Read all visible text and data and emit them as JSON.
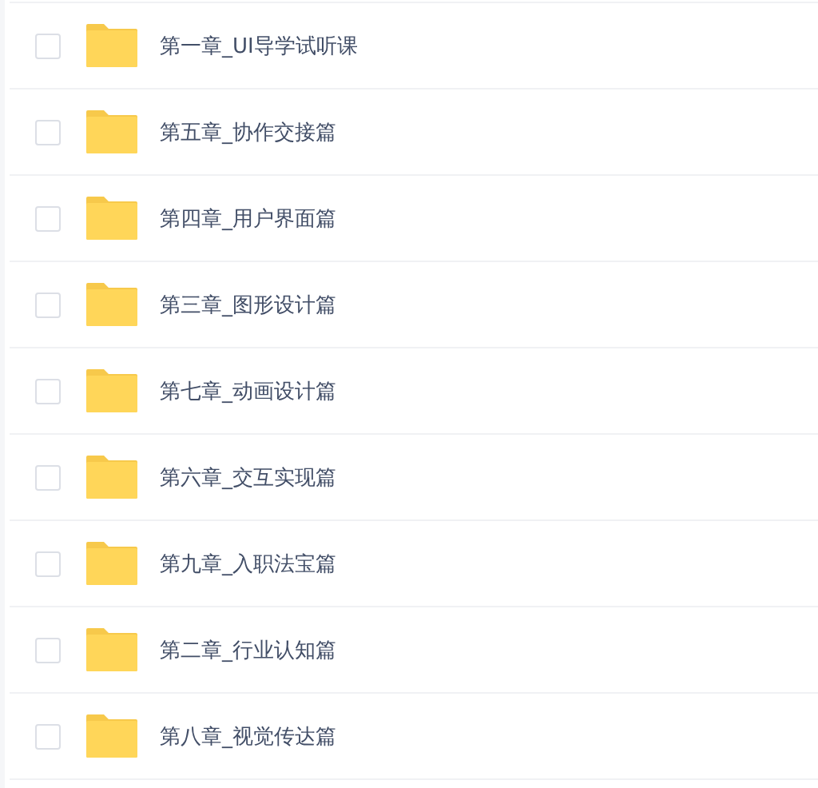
{
  "files": [
    {
      "name": "第一章_UI导学试听课",
      "checked": false
    },
    {
      "name": "第五章_协作交接篇",
      "checked": false
    },
    {
      "name": "第四章_用户界面篇",
      "checked": false
    },
    {
      "name": "第三章_图形设计篇",
      "checked": false
    },
    {
      "name": "第七章_动画设计篇",
      "checked": false
    },
    {
      "name": "第六章_交互实现篇",
      "checked": false
    },
    {
      "name": "第九章_入职法宝篇",
      "checked": false
    },
    {
      "name": "第二章_行业认知篇",
      "checked": false
    },
    {
      "name": "第八章_视觉传达篇",
      "checked": false
    }
  ]
}
